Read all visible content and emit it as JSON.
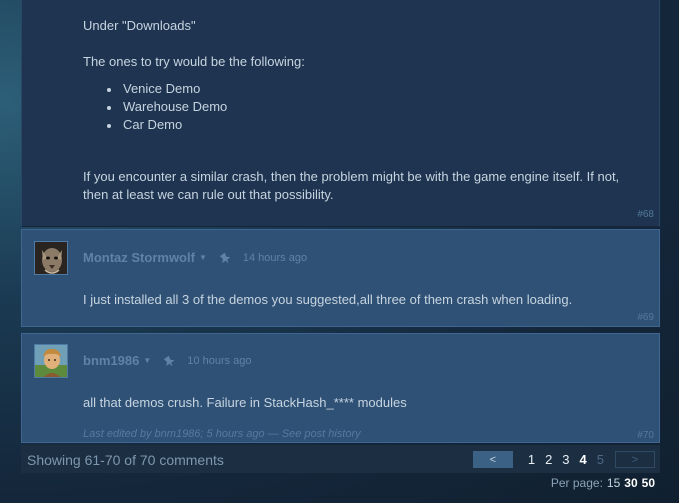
{
  "post1": {
    "intro": "Under \"Downloads\"",
    "lead": "The ones to try would be the following:",
    "demos": [
      "Venice Demo",
      "Warehouse Demo",
      "Car Demo"
    ],
    "closing": "If you encounter a similar crash, then the problem might be with the game engine itself. If not, then at least we can rule out that possibility.",
    "number": "#68"
  },
  "post2": {
    "author": "Montaz Stormwolf",
    "time": "14 hours ago",
    "message": "I just installed all 3 of the demos you suggested,all three of them crash when loading.",
    "number": "#69",
    "avatar_icon": "wolf-portrait"
  },
  "post3": {
    "author": "bnm1986",
    "time": "10 hours ago",
    "message": "all that demos crush. Failure in StackHash_**** modules",
    "edited": "Last edited by bnm1986; 5 hours ago — See post history",
    "number": "#70",
    "avatar_icon": "portrait"
  },
  "footer": {
    "showing": "Showing 61-70 of 70 comments",
    "prev_label": "<",
    "next_label": ">",
    "pages": [
      "1",
      "2",
      "3",
      "4",
      "5"
    ],
    "current_page": "4",
    "per_page_label": "Per page:",
    "per_page_options": [
      "15",
      "30",
      "50"
    ]
  },
  "colors": {
    "post_bg": "#305176",
    "post_bg_dark": "#1e3450",
    "text": "#c6d4df",
    "author": "#5e83a5"
  }
}
